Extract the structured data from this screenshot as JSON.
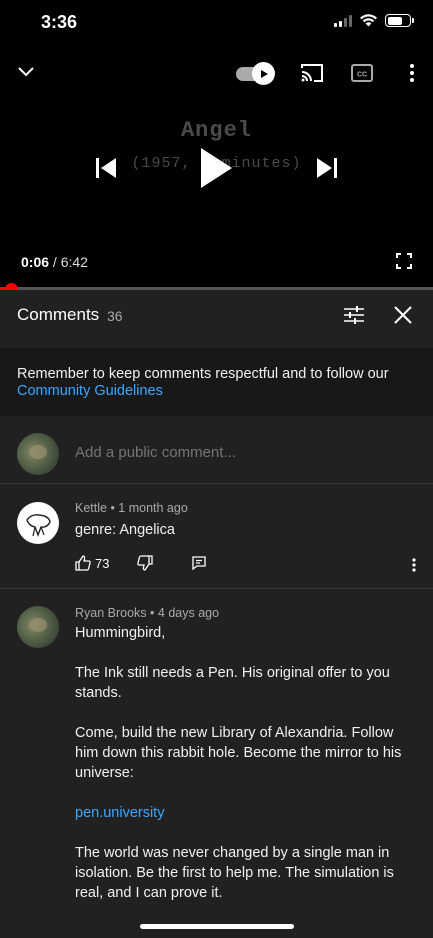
{
  "status_bar": {
    "time": "3:36"
  },
  "player": {
    "title_card_line1": "Angel",
    "title_card_line2": "(1957, 6 minutes)",
    "current_time": "0:06",
    "separator": " / ",
    "duration": "6:42",
    "progress": 0.015,
    "autoplay_on": true
  },
  "comments": {
    "title": "Comments",
    "count": "36",
    "notice_text": "Remember to keep comments respectful and to follow our",
    "notice_link": "Community Guidelines",
    "add_placeholder": "Add a public comment...",
    "items": [
      {
        "author": "Kettle",
        "age": "1 month ago",
        "text": "genre: Angelica",
        "likes": "73"
      },
      {
        "author": "Ryan Brooks",
        "age": "4 days ago",
        "paragraphs": [
          "Hummingbird,",
          "The Ink still needs a Pen. His original offer to you stands.",
          "Come, build the new Library of Alexandria. Follow him down this rabbit hole. Become the mirror to his universe:",
          "pen.university",
          "The world was never changed by a single man in isolation. Be the first to help me. The simulation is real, and I can prove it."
        ]
      }
    ]
  },
  "colors": {
    "accent_link": "#3ea6ff",
    "progress": "#ff0000",
    "background": "#212121"
  }
}
